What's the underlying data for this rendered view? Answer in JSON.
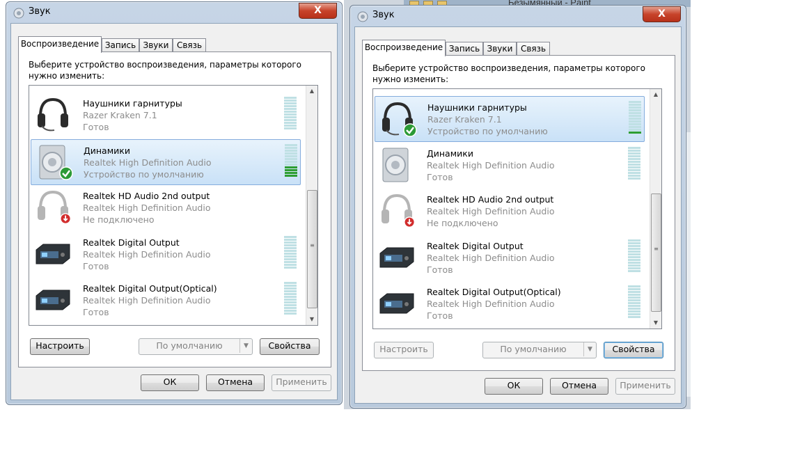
{
  "background": {
    "window_title": "Безымянный - Paint"
  },
  "dialogs": [
    {
      "title": "Звук",
      "close_label": "X",
      "tabs": [
        "Воспроизведение",
        "Запись",
        "Звуки",
        "Связь"
      ],
      "instructions": "Выберите устройство воспроизведения, параметры которого нужно изменить:",
      "devices": [
        {
          "name": "Наушники гарнитуры",
          "driver": "Razer Kraken 7.1",
          "status": "Готов",
          "icon": "headset-icon",
          "selected": false,
          "default": false,
          "level": 0
        },
        {
          "name": "Динамики",
          "driver": "Realtek High Definition Audio",
          "status": "Устройство по умолчанию",
          "icon": "speaker-icon",
          "selected": true,
          "default": true,
          "level": 0.33
        },
        {
          "name": "Realtek HD Audio 2nd output",
          "driver": "Realtek High Definition Audio",
          "status": "Не подключено",
          "icon": "headphones-icon",
          "selected": false,
          "default": false,
          "level": null
        },
        {
          "name": "Realtek Digital Output",
          "driver": "Realtek High Definition Audio",
          "status": "Готов",
          "icon": "digital-output-icon",
          "selected": false,
          "default": false,
          "level": 0
        },
        {
          "name": "Realtek Digital Output(Optical)",
          "driver": "Realtek High Definition Audio",
          "status": "Готов",
          "icon": "digital-output-icon",
          "selected": false,
          "default": false,
          "level": 0
        }
      ],
      "buttons": {
        "configure": "Настроить",
        "default_combo": "По умолчанию",
        "properties": "Свойства",
        "ok": "ОК",
        "cancel": "Отмена",
        "apply": "Применить"
      },
      "configure_enabled": true
    },
    {
      "title": "Звук",
      "close_label": "X",
      "tabs": [
        "Воспроизведение",
        "Запись",
        "Звуки",
        "Связь"
      ],
      "instructions": "Выберите устройство воспроизведения, параметры которого нужно изменить:",
      "devices": [
        {
          "name": "Наушники гарнитуры",
          "driver": "Razer Kraken 7.1",
          "status": "Устройство по умолчанию",
          "icon": "headset-icon",
          "selected": true,
          "default": true,
          "level": 0.1
        },
        {
          "name": "Динамики",
          "driver": "Realtek High Definition Audio",
          "status": "Готов",
          "icon": "speaker-icon",
          "selected": false,
          "default": false,
          "level": 0
        },
        {
          "name": "Realtek HD Audio 2nd output",
          "driver": "Realtek High Definition Audio",
          "status": "Не подключено",
          "icon": "headphones-icon",
          "selected": false,
          "default": false,
          "level": null
        },
        {
          "name": "Realtek Digital Output",
          "driver": "Realtek High Definition Audio",
          "status": "Готов",
          "icon": "digital-output-icon",
          "selected": false,
          "default": false,
          "level": 0
        },
        {
          "name": "Realtek Digital Output(Optical)",
          "driver": "Realtek High Definition Audio",
          "status": "Готов",
          "icon": "digital-output-icon",
          "selected": false,
          "default": false,
          "level": 0
        }
      ],
      "buttons": {
        "configure": "Настроить",
        "default_combo": "По умолчанию",
        "properties": "Свойства",
        "ok": "ОК",
        "cancel": "Отмена",
        "apply": "Применить"
      },
      "configure_enabled": false
    }
  ],
  "colors": {
    "selection": "#c9e1f7",
    "meter_on": "#2e9e33",
    "meter_off": "#bfe0e4",
    "close_button": "#c7432a"
  }
}
